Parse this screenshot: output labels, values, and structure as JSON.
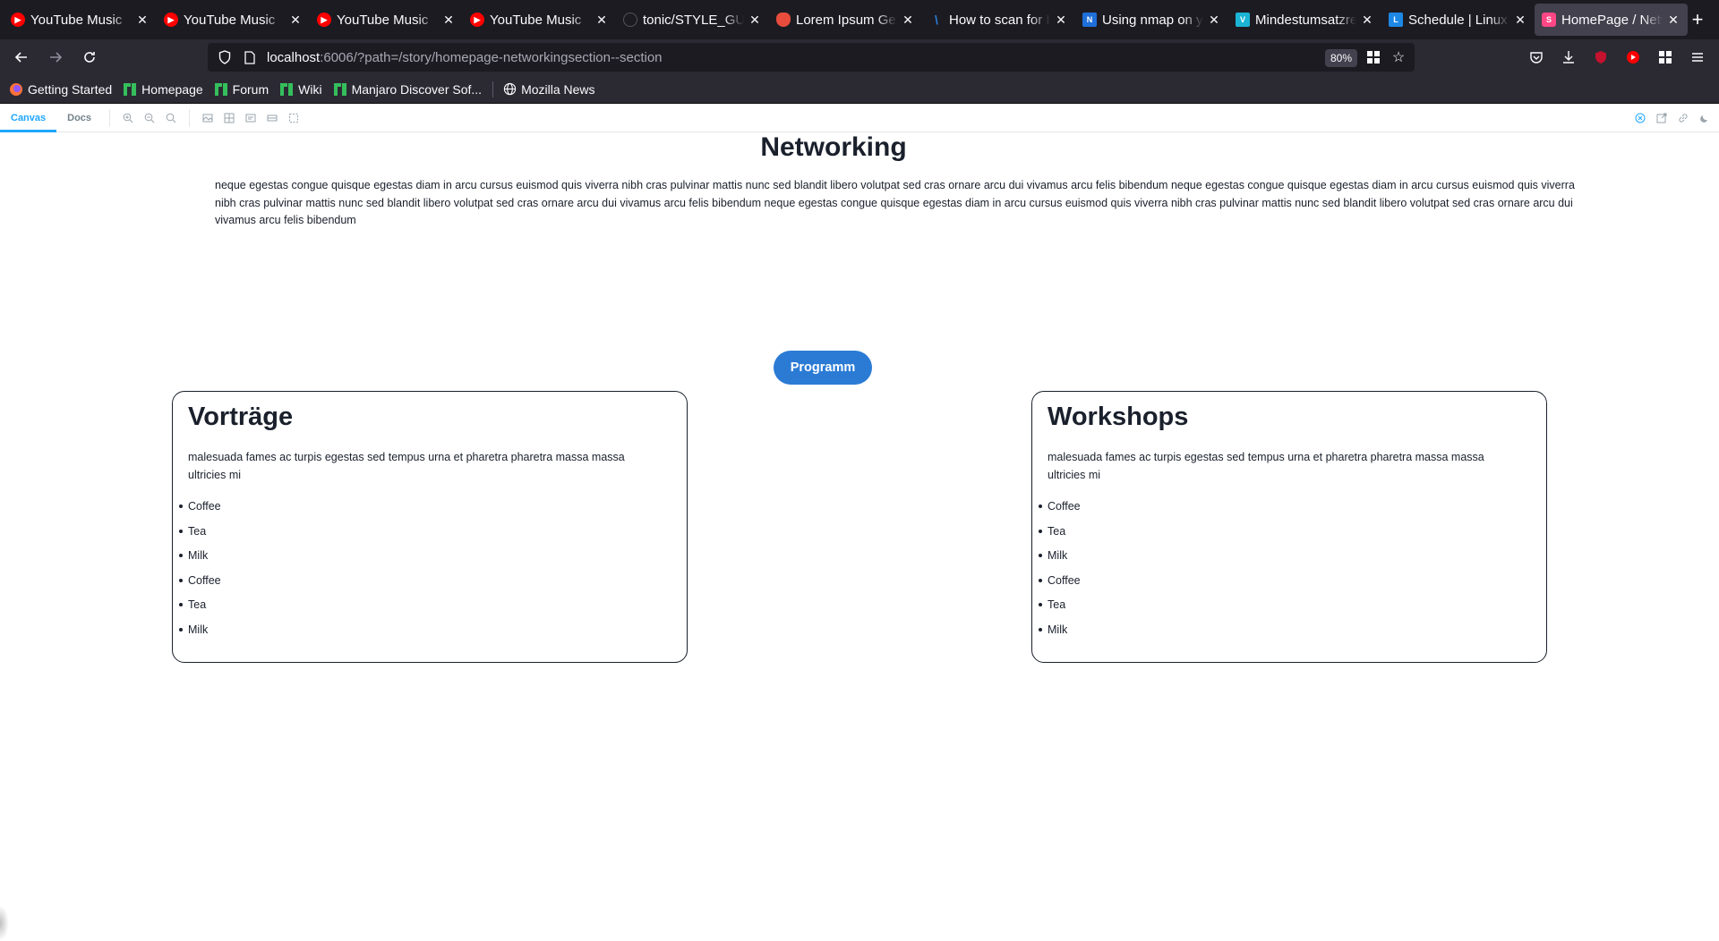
{
  "browser": {
    "tabs": [
      {
        "title": "YouTube Music",
        "icon": "youtube-music-icon",
        "color": "#ff0000"
      },
      {
        "title": "YouTube Music",
        "icon": "youtube-music-icon",
        "color": "#ff0000"
      },
      {
        "title": "YouTube Music",
        "icon": "youtube-music-icon",
        "color": "#ff0000"
      },
      {
        "title": "YouTube Music",
        "icon": "youtube-music-icon",
        "color": "#ff0000"
      },
      {
        "title": "tonic/STYLE_GUID",
        "icon": "github-icon",
        "color": "#1c1b22"
      },
      {
        "title": "Lorem Ipsum Gen",
        "icon": "lorem-ipsum-icon",
        "color": "#e74c3c"
      },
      {
        "title": "How to scan for IP",
        "icon": "slash-icon",
        "color": "#2b7bd5"
      },
      {
        "title": "Using nmap on yo",
        "icon": "nw-icon",
        "color": "#1e6fd9"
      },
      {
        "title": "Mindestumsatzrec",
        "icon": "v-icon",
        "color": "#1cb4d4"
      },
      {
        "title": "Schedule | Linux I",
        "icon": "l-icon",
        "color": "#1e88e5"
      },
      {
        "title": "HomePage / Netw",
        "icon": "storybook-icon",
        "color": "#ff4785",
        "active": true
      }
    ],
    "url_host": "localhost",
    "url_rest": ":6006/?path=/story/homepage-networkingsection--section",
    "zoom": "80%",
    "bookmarks": [
      {
        "label": "Getting Started",
        "icon": "firefox-icon"
      },
      {
        "label": "Homepage",
        "icon": "manjaro-icon"
      },
      {
        "label": "Forum",
        "icon": "manjaro-icon"
      },
      {
        "label": "Wiki",
        "icon": "manjaro-icon"
      },
      {
        "label": "Manjaro Discover Sof...",
        "icon": "manjaro-icon"
      },
      {
        "label": "Mozilla News",
        "icon": "globe-icon"
      }
    ]
  },
  "storybook": {
    "tabs": [
      {
        "label": "Canvas",
        "active": true
      },
      {
        "label": "Docs",
        "active": false
      }
    ]
  },
  "section": {
    "title": "Networking",
    "intro": "neque egestas congue quisque egestas diam in arcu cursus euismod quis viverra nibh cras pulvinar mattis nunc sed blandit libero volutpat sed cras ornare arcu dui vivamus arcu felis bibendum neque egestas congue quisque egestas diam in arcu cursus euismod quis viverra nibh cras pulvinar mattis nunc sed blandit libero volutpat sed cras ornare arcu dui vivamus arcu felis bibendum neque egestas congue quisque egestas diam in arcu cursus euismod quis viverra nibh cras pulvinar mattis nunc sed blandit libero volutpat sed cras ornare arcu dui vivamus arcu felis bibendum",
    "button_label": "Programm",
    "button_color": "#2b7bd5",
    "cards": [
      {
        "title": "Vorträge",
        "text": "malesuada fames ac turpis egestas sed tempus urna et pharetra pharetra massa massa ultricies mi",
        "items": [
          "Coffee",
          "Tea",
          "Milk",
          "Coffee",
          "Tea",
          "Milk"
        ]
      },
      {
        "title": "Workshops",
        "text": "malesuada fames ac turpis egestas sed tempus urna et pharetra pharetra massa massa ultricies mi",
        "items": [
          "Coffee",
          "Tea",
          "Milk",
          "Coffee",
          "Tea",
          "Milk"
        ]
      }
    ]
  }
}
